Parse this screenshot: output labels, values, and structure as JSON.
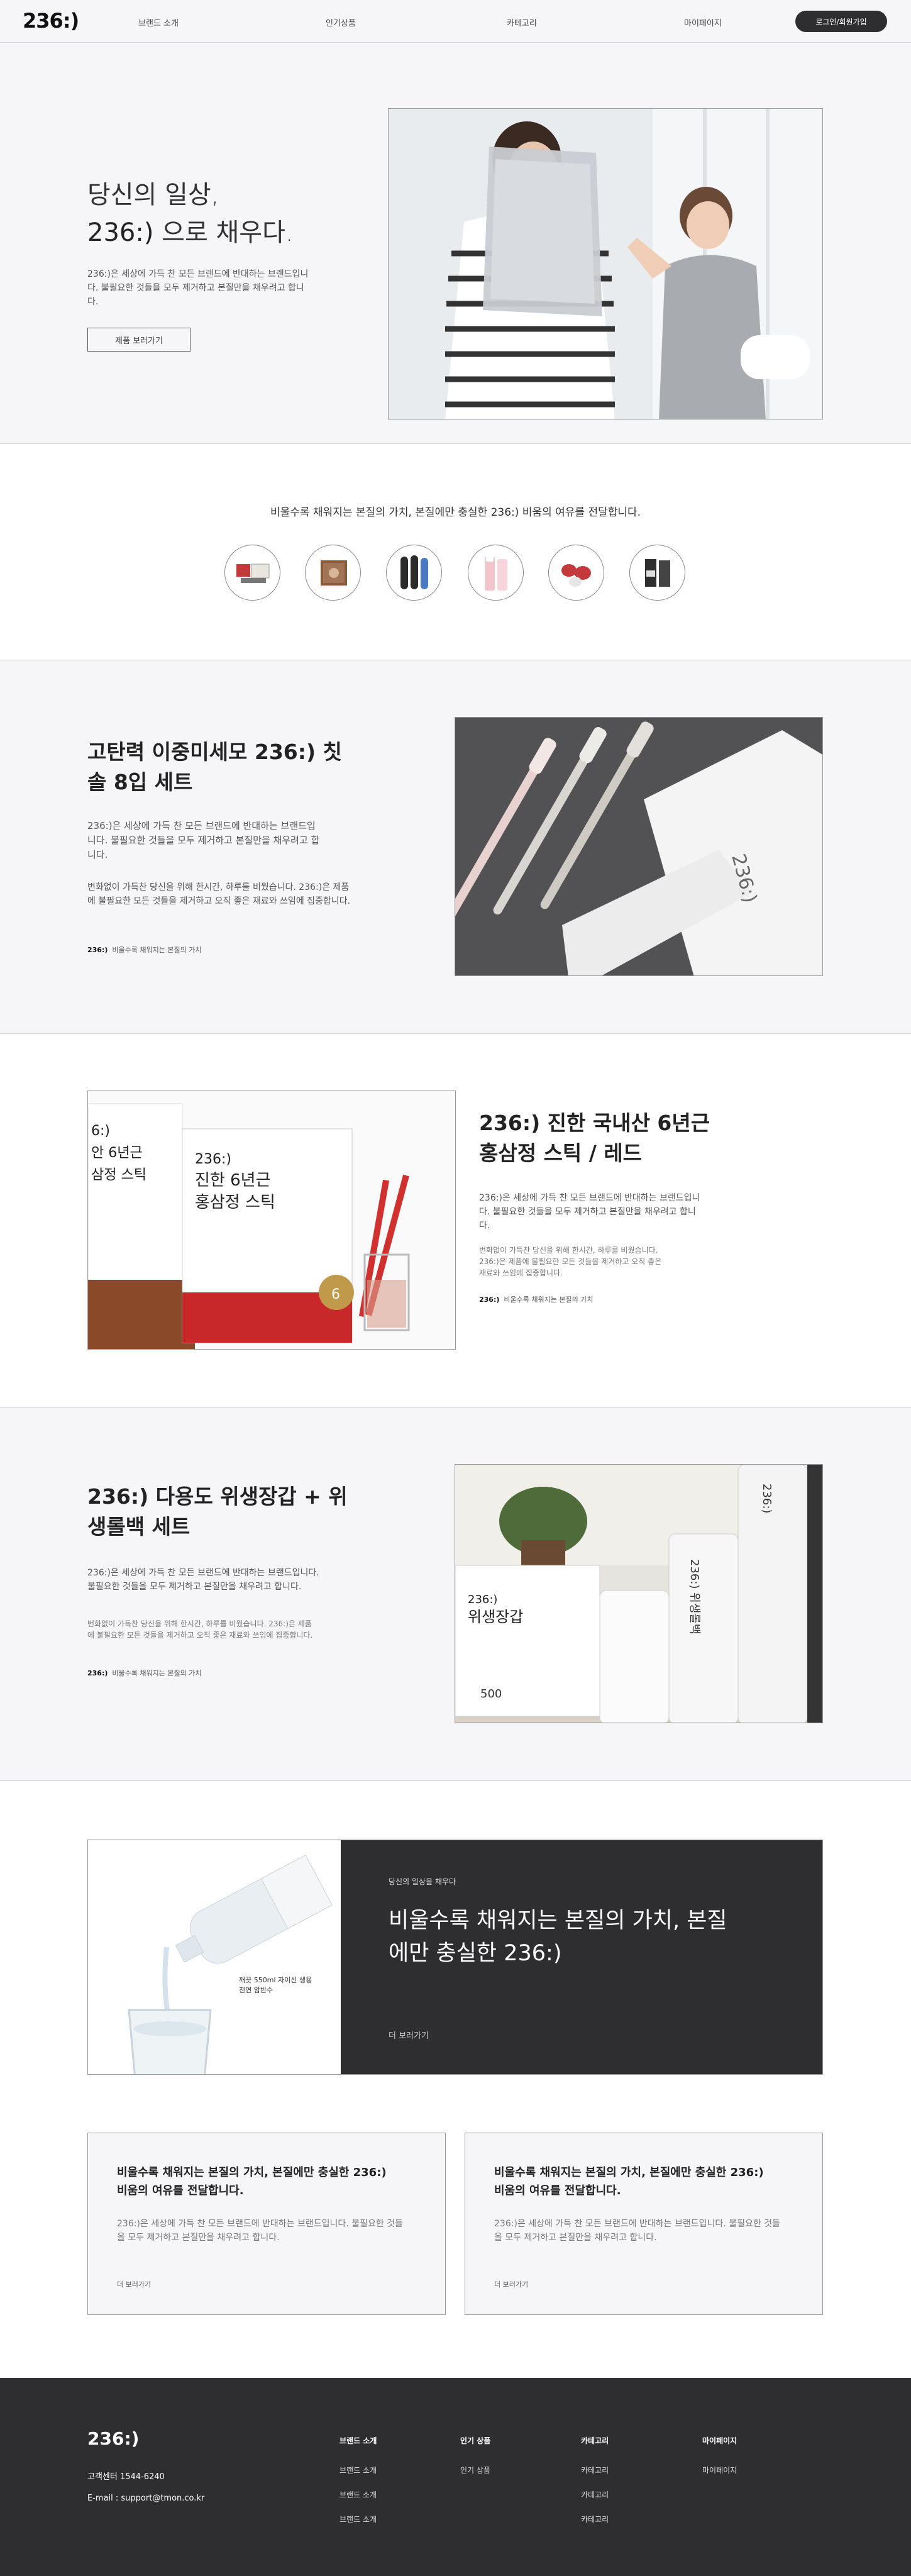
{
  "header": {
    "logo": "236:)",
    "nav": [
      "브랜드 소개",
      "인기상품",
      "카테고리",
      "마이페이지"
    ],
    "login": "로그인/회원가입"
  },
  "hero": {
    "title_line1": "당신의 일상,",
    "title_brand": "236:)",
    "title_rest": " 으로 채우다.",
    "desc": "236:)은 세상에 가득 찬 모든 브랜드에 반대하는 브랜드입니다. 불필요한 것들을 모두 제거하고 본질만을 채우려고 합니다.",
    "button": "제품 보러가기"
  },
  "categories": {
    "text": "비울수록 채워지는 본질의 가치, 본질에만 충실한 236:) 비움의 여유를 전달합니다."
  },
  "product1": {
    "title": "고탄력 이중미세모 236:) 칫솔 8입 세트",
    "desc": "236:)은 세상에 가득 찬 모든 브랜드에 반대하는 브랜드입니다. 불필요한 것들을 모두 제거하고 본질만을 채우려고 합니다.",
    "desc2": "번화없이 가득찬 당신을 위해 한시간, 하루를 비웠습니다. 236:)은 제품에 불필요한 모든 것들을 제거하고 오직 좋은 재료와 쓰임에 집중합니다.",
    "brand": "236:)",
    "tagline": "비울수록 채워지는 본질의 가치"
  },
  "product2": {
    "title": "236:) 진한 국내산 6년근 홍삼정 스틱 / 레드",
    "desc": "236:)은 세상에 가득 찬 모든 브랜드에 반대하는 브랜드입니다. 불필요한 것들을 모두 제거하고 본질만을 채우려고 합니다.",
    "desc2": "번화없이 가득찬 당신을 위해 한시간, 하루를 비웠습니다. 236:)은 제품에 불필요한 모든 것들을 제거하고 오직 좋은 재료와 쓰임에 집중합니다.",
    "brand": "236:)",
    "tagline": "비울수록 채워지는 본질의 가치"
  },
  "product3": {
    "title": "236:) 다용도 위생장갑 + 위생롤백 세트",
    "desc": "236:)은 세상에 가득 찬 모든 브랜드에 반대하는 브랜드입니다. 불필요한 것들을 모두 제거하고 본질만을 채우려고 합니다.",
    "desc2": "번화없이 가득찬 당신을 위해 한시간, 하루를 비웠습니다. 236:)은 제품에 불필요한 모든 것들을 제거하고 오직 좋은 재료와 쓰임에 집중합니다.",
    "brand": "236:)",
    "tagline": "비울수록 채워지는 본질의 가치"
  },
  "banner": {
    "eyebrow": "당신의 일상을 채우다",
    "title": "비울수록 채워지는 본질의 가치, 본질에만 충실한 236:)",
    "link": "더 보러가기",
    "bottle_caption": "깨끗 550ml 자이신 생용 천연 암반수"
  },
  "cards": [
    {
      "title": "비울수록 채워지는 본질의 가치, 본질에만 충실한 236:) 비움의 여유를 전달합니다.",
      "desc": "236:)은 세상에 가득 찬 모든 브랜드에 반대하는 브랜드입니다. 불필요한 것들을 모두 제거하고 본질만을 채우려고 합니다.",
      "link": "더 보러가기"
    },
    {
      "title": "비울수록 채워지는 본질의 가치, 본질에만 충실한 236:) 비움의 여유를 전달합니다.",
      "desc": "236:)은 세상에 가득 찬 모든 브랜드에 반대하는 브랜드입니다. 불필요한 것들을 모두 제거하고 본질만을 채우려고 합니다.",
      "link": "더 보러가기"
    }
  ],
  "footer": {
    "logo": "236:)",
    "cs": "고객센터  1544-6240",
    "email": "E-mail : support@tmon.co.kr",
    "cols": [
      {
        "head": "브랜드 소개",
        "links": [
          "브랜드 소개",
          "브랜드 소개",
          "브랜드 소개"
        ]
      },
      {
        "head": "인기 상품",
        "links": [
          "인기 상품"
        ]
      },
      {
        "head": "카테고리",
        "links": [
          "카테고리",
          "카테고리",
          "카테고리"
        ]
      },
      {
        "head": "마이페이지",
        "links": [
          "마이페이지"
        ]
      }
    ]
  }
}
